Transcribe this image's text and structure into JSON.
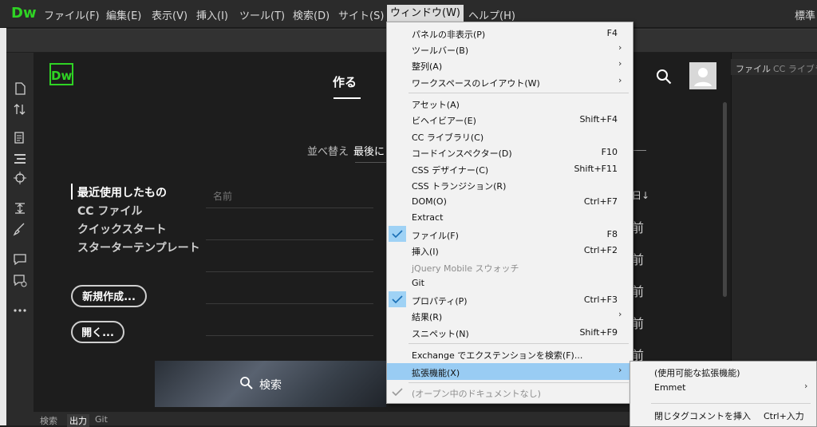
{
  "app": {
    "logo": "Dw",
    "right_label": "標準"
  },
  "menubar": {
    "items": [
      {
        "label": "ファイル(F)"
      },
      {
        "label": "編集(E)"
      },
      {
        "label": "表示(V)"
      },
      {
        "label": "挿入(I)"
      },
      {
        "label": "ツール(T)"
      },
      {
        "label": "検索(D)"
      },
      {
        "label": "サイト(S)"
      },
      {
        "label": "ウィンドウ(W)"
      },
      {
        "label": "ヘルプ(H)"
      }
    ]
  },
  "start": {
    "logo": "Dw",
    "tab": "作る",
    "sort_label": "並べ替え",
    "sort_value": "最後に",
    "nav": [
      "最近使用したもの",
      "CC ファイル",
      "クイックスタート",
      "スターターテンプレート"
    ],
    "col_name": "名前",
    "col_date": "日↓",
    "date_cells": [
      "前",
      "前",
      "前",
      "前",
      "前"
    ],
    "new_button": "新規作成...",
    "open_button": "開く...",
    "search_text": "検索"
  },
  "right_panel": {
    "tab_files": "ファイル",
    "tab_cclib": "CC ライブラリ"
  },
  "bottom_tabs": [
    "検索",
    "出力",
    "Git"
  ],
  "window_menu": {
    "items": [
      {
        "label": "パネルの非表示(P)",
        "shortcut": "F4"
      },
      {
        "label": "ツールバー(B)",
        "submenu": true
      },
      {
        "label": "整列(A)",
        "submenu": true
      },
      {
        "label": "ワークスペースのレイアウト(W)",
        "submenu": true
      },
      {
        "label": "アセット(A)"
      },
      {
        "label": "ビヘイビアー(E)",
        "shortcut": "Shift+F4"
      },
      {
        "label": "CC ライブラリ(C)"
      },
      {
        "label": "コードインスペクター(D)",
        "shortcut": "F10"
      },
      {
        "label": "CSS デザイナー(C)",
        "shortcut": "Shift+F11"
      },
      {
        "label": "CSS トランジション(R)"
      },
      {
        "label": "DOM(O)",
        "shortcut": "Ctrl+F7"
      },
      {
        "label": "Extract"
      },
      {
        "label": "ファイル(F)",
        "shortcut": "F8",
        "checked": true
      },
      {
        "label": "挿入(I)",
        "shortcut": "Ctrl+F2"
      },
      {
        "label": "jQuery Mobile スウォッチ",
        "disabled": true
      },
      {
        "label": "Git"
      },
      {
        "label": "プロパティ(P)",
        "shortcut": "Ctrl+F3",
        "checked": true
      },
      {
        "label": "結果(R)",
        "submenu": true
      },
      {
        "label": "スニペット(N)",
        "shortcut": "Shift+F9"
      },
      {
        "label": "Exchange でエクステンションを検索(F)..."
      },
      {
        "label": "拡張機能(X)",
        "submenu": true,
        "highlighted": true
      },
      {
        "label": "(オープン中のドキュメントなし)",
        "disabled": true,
        "checked": true
      }
    ]
  },
  "extensions_submenu": {
    "items": [
      {
        "label": "(使用可能な拡張機能)"
      },
      {
        "label": "Emmet",
        "submenu": true
      },
      {
        "label": "閉じタグコメントを挿入",
        "shortcut": "Ctrl+入力"
      }
    ]
  },
  "colors": {
    "accent": "#2fd324",
    "highlight": "#99ccf3"
  },
  "icons": {
    "arrow": "›",
    "check": "✓"
  }
}
